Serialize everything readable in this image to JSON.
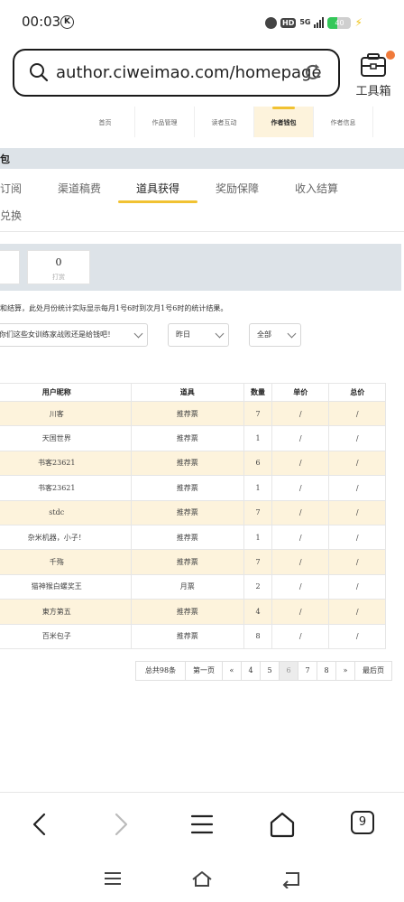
{
  "status_bar": {
    "time": "00:03",
    "k_badge": "K",
    "hd": "HD",
    "net": "5G",
    "battery": "40"
  },
  "browser": {
    "url": "author.ciweimao.com/homepage",
    "toolbox_label": "工具箱",
    "tab_count": "9"
  },
  "site_nav": [
    "首页",
    "作品管理",
    "读者互动",
    "作者钱包",
    "作者信息"
  ],
  "section": {
    "title": "包"
  },
  "subtabs": {
    "row1": [
      "订阅",
      "渠道稿费",
      "道具获得",
      "奖励保障",
      "收入结算"
    ],
    "row2": "兑换",
    "active": "道具获得"
  },
  "stats": {
    "card_value": "0",
    "card_label": "打赏"
  },
  "note": "和结算，此处月份统计实际显示每月1号6时到次月1号6时的统计结果。",
  "filters": {
    "book": "你们这些女训练家战败还是给钱吧！",
    "date": "昨日",
    "type": "全部"
  },
  "table": {
    "headers": [
      "用户昵称",
      "道具",
      "数量",
      "单价",
      "总价"
    ],
    "rows": [
      [
        "川客",
        "推荐票",
        "7",
        "/",
        "/"
      ],
      [
        "天国世界",
        "推荐票",
        "1",
        "/",
        "/"
      ],
      [
        "书客23621",
        "推荐票",
        "6",
        "/",
        "/"
      ],
      [
        "书客23621",
        "推荐票",
        "1",
        "/",
        "/"
      ],
      [
        "stdc",
        "推荐票",
        "7",
        "/",
        "/"
      ],
      [
        "杂米机器，小子！",
        "推荐票",
        "1",
        "/",
        "/"
      ],
      [
        "千殇",
        "推荐票",
        "7",
        "/",
        "/"
      ],
      [
        "猫神猴白螺奖王",
        "月票",
        "2",
        "/",
        "/"
      ],
      [
        "東方第五",
        "推荐票",
        "4",
        "/",
        "/"
      ],
      [
        "百米包子",
        "推荐票",
        "8",
        "/",
        "/"
      ]
    ]
  },
  "pagination": {
    "total": "总共98条",
    "first": "第一页",
    "prev": "«",
    "pages": [
      "4",
      "5",
      "6",
      "7",
      "8"
    ],
    "current": "6",
    "next": "»",
    "last": "最后页"
  },
  "colors": {
    "accent": "#f1c232",
    "row_highlight": "#fdf3dc",
    "banner": "#dde3e8"
  }
}
